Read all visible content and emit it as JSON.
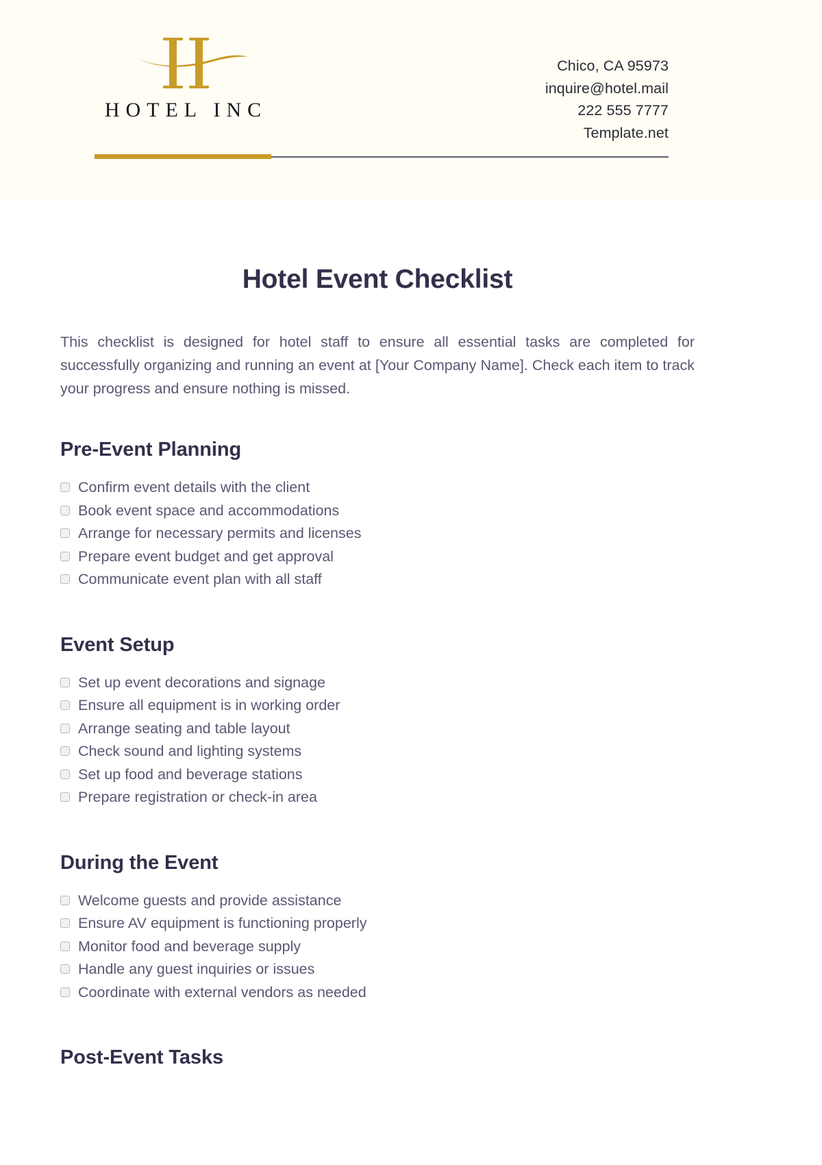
{
  "header": {
    "logo": {
      "mark_icon": "hotel-h-monogram-icon",
      "wordmark": "HOTEL INC",
      "gold_color": "#c99c28"
    },
    "contact": [
      "Chico, CA 95973",
      "inquire@hotel.mail",
      "222 555 7777",
      "Template.net"
    ],
    "background_color": "#fffdf4",
    "divider": {
      "gold_color": "#c99c28",
      "grey_color": "#5e5e66"
    }
  },
  "document": {
    "title": "Hotel Event Checklist",
    "intro": "This checklist is designed for hotel staff to ensure all essential tasks are completed for successfully organizing and running an event at [Your Company Name]. Check each item to track your progress and ensure nothing is missed.",
    "heading_color": "#32304a",
    "body_color": "#585873"
  },
  "sections": [
    {
      "heading": "Pre-Event Planning",
      "items": [
        "Confirm event details with the client",
        "Book event space and accommodations",
        "Arrange for necessary permits and licenses",
        "Prepare event budget and get approval",
        "Communicate event plan with all staff"
      ]
    },
    {
      "heading": "Event Setup",
      "items": [
        "Set up event decorations and signage",
        "Ensure all equipment is in working order",
        "Arrange seating and table layout",
        "Check sound and lighting systems",
        "Set up food and beverage stations",
        "Prepare registration or check-in area"
      ]
    },
    {
      "heading": "During the Event",
      "items": [
        "Welcome guests and provide assistance",
        "Ensure AV equipment is functioning properly",
        "Monitor food and beverage supply",
        "Handle any guest inquiries or issues",
        "Coordinate with external vendors as needed"
      ]
    },
    {
      "heading": "Post-Event Tasks",
      "items": []
    }
  ]
}
